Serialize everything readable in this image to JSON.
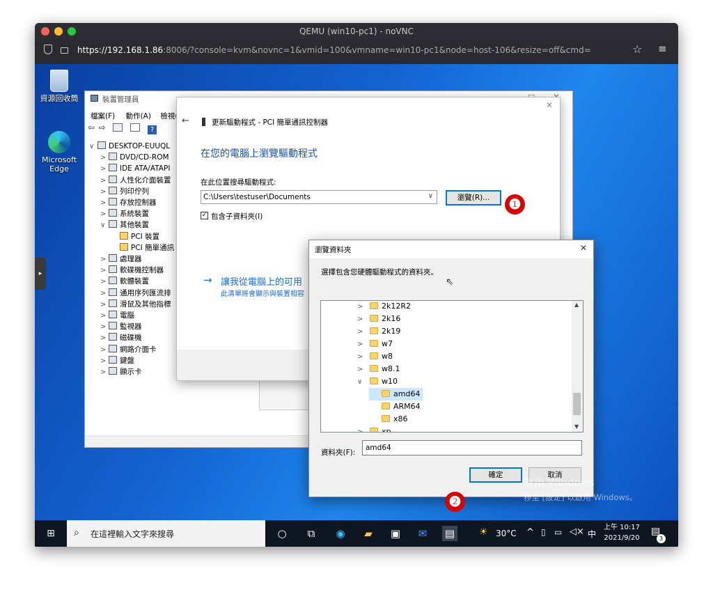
{
  "browser": {
    "window_title": "QEMU (win10-pc1) - noVNC",
    "url_host": "https://192.168.1.86",
    "url_rest": ":8006/?console=kvm&novnc=1&vmid=100&vmname=win10-pc1&node=host-106&resize=off&cmd="
  },
  "desktop": {
    "icons": [
      {
        "label": "資源回收筒"
      },
      {
        "label": "Microsoft Edge"
      }
    ]
  },
  "devmgr": {
    "title": "裝置管理員",
    "menus": [
      "檔案(F)",
      "動作(A)",
      "檢視("
    ],
    "tree": [
      {
        "chev": "∨",
        "label": "DESKTOP-EUUQL",
        "indent": 0
      },
      {
        "chev": ">",
        "label": "DVD/CD-ROM",
        "indent": 1
      },
      {
        "chev": ">",
        "label": "IDE ATA/ATAPI",
        "indent": 1
      },
      {
        "chev": ">",
        "label": "人性化介面裝置",
        "indent": 1
      },
      {
        "chev": ">",
        "label": "列印佇列",
        "indent": 1
      },
      {
        "chev": ">",
        "label": "存放控制器",
        "indent": 1
      },
      {
        "chev": ">",
        "label": "系統裝置",
        "indent": 1
      },
      {
        "chev": "∨",
        "label": "其他裝置",
        "indent": 1
      },
      {
        "chev": "",
        "label": "PCI 裝置",
        "indent": 2
      },
      {
        "chev": "",
        "label": "PCI 簡單通訊",
        "indent": 2
      },
      {
        "chev": ">",
        "label": "處理器",
        "indent": 1
      },
      {
        "chev": ">",
        "label": "軟碟機控制器",
        "indent": 1
      },
      {
        "chev": ">",
        "label": "軟體裝置",
        "indent": 1
      },
      {
        "chev": ">",
        "label": "通用序列匯流排",
        "indent": 1
      },
      {
        "chev": ">",
        "label": "滑鼠及其他指標",
        "indent": 1
      },
      {
        "chev": ">",
        "label": "電腦",
        "indent": 1
      },
      {
        "chev": ">",
        "label": "監視器",
        "indent": 1
      },
      {
        "chev": ">",
        "label": "磁碟機",
        "indent": 1
      },
      {
        "chev": ">",
        "label": "網路介面卡",
        "indent": 1
      },
      {
        "chev": ">",
        "label": "鍵盤",
        "indent": 1
      },
      {
        "chev": ">",
        "label": "顯示卡",
        "indent": 1
      }
    ]
  },
  "wizard": {
    "header": "更新驅動程式 - PCI 簡單通訊控制器",
    "heading": "在您的電腦上瀏覽驅動程式",
    "search_label": "在此位置搜尋驅動程式:",
    "path_value": "C:\\Users\\testuser\\Documents",
    "browse_button": "瀏覽(R)...",
    "include_subfolders": "包含子資料夾(I)",
    "link_text": "讓我從電腦上的可用",
    "link_sub": "此清單將會顯示與裝置相容"
  },
  "browse_dialog": {
    "title": "瀏覽資料夾",
    "prompt": "選擇包含您硬體驅動程式的資料夾。",
    "tree": [
      {
        "label": "2k12R2",
        "chev": ">",
        "indent": 0
      },
      {
        "label": "2k16",
        "chev": ">",
        "indent": 0
      },
      {
        "label": "2k19",
        "chev": ">",
        "indent": 0
      },
      {
        "label": "w7",
        "chev": ">",
        "indent": 0
      },
      {
        "label": "w8",
        "chev": ">",
        "indent": 0
      },
      {
        "label": "w8.1",
        "chev": ">",
        "indent": 0
      },
      {
        "label": "w10",
        "chev": "∨",
        "indent": 0
      },
      {
        "label": "amd64",
        "chev": "",
        "indent": 1
      },
      {
        "label": "ARM64",
        "chev": "",
        "indent": 1
      },
      {
        "label": "x86",
        "chev": "",
        "indent": 1
      },
      {
        "label": "xp",
        "chev": ">",
        "indent": 0
      }
    ],
    "selected": "amd64",
    "folder_label": "資料夾(F):",
    "folder_value": "amd64",
    "ok_button": "確定",
    "cancel_button": "取消"
  },
  "badges": [
    "❶",
    "❷"
  ],
  "watermark": {
    "line1": "啟用 Windows",
    "line2": "移至 [設定] 以啟用 Windows。"
  },
  "taskbar": {
    "search_placeholder": "在這裡輸入文字來搜尋",
    "weather": "30°C",
    "ime": "中",
    "time": "上午 10:17",
    "date": "2021/9/20",
    "notifications": "3"
  }
}
